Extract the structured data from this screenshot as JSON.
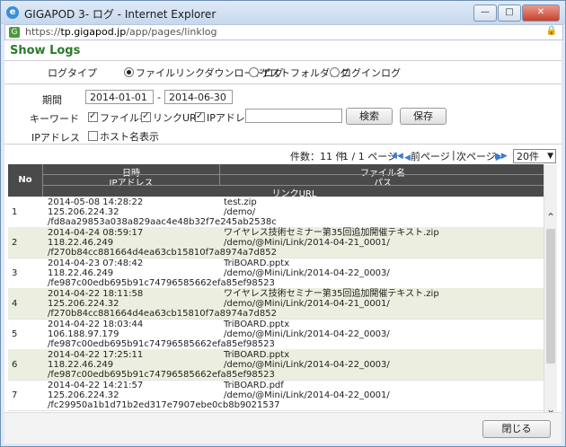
{
  "window": {
    "title": "GIGAPOD 3- ログ - Internet Explorer",
    "url_prefix": "https://",
    "url_host": "tp.gigapod.jp",
    "url_path": "/app/pages/linklog"
  },
  "page": {
    "heading": "Show Logs"
  },
  "filters": {
    "log_type_label": "ログタイプ",
    "log_types": [
      "ファイルリンクダウンロードログ",
      "ゲストフォルダログ",
      "ログインログ"
    ],
    "period_label": "期間",
    "date_from": "2014-01-01",
    "date_sep": "-",
    "date_to": "2014-06-30",
    "keyword_label": "キーワード",
    "kw_filename": "ファイル名",
    "kw_link_url": "リンクURL",
    "kw_ip": "IPアドレス",
    "keyword_value": "",
    "search_button": "検索",
    "save_button": "保存",
    "ip_label": "IPアドレス",
    "show_hostname": "ホスト名表示"
  },
  "pager": {
    "count_text": "件数：11 件",
    "page_text": "1 / 1 ページ",
    "prev": "前ページ",
    "divider": "|",
    "next": "次ページ",
    "per_page": "20件"
  },
  "table": {
    "h_no": "No",
    "h_datetime": "日時",
    "h_filename": "ファイル名",
    "h_ip": "IPアドレス",
    "h_path": "パス",
    "h_link": "リンクURL",
    "rows": [
      {
        "no": "1",
        "datetime": "2014-05-08 14:28:22",
        "file": "test.zip",
        "ip": "125.206.224.32",
        "path": "/demo/",
        "link": "/fd8aa29853a038a829aac4e48b32f7e245ab2538c"
      },
      {
        "no": "2",
        "datetime": "2014-04-24 08:59:17",
        "file": "ワイヤレス技術セミナー第35回追加開催テキスト.zip",
        "ip": "118.22.46.249",
        "path": "/demo/@Mini/Link/2014-04-21_0001/",
        "link": "/f270b84cc881664d4ea63cb15810f7a8974a7d852"
      },
      {
        "no": "3",
        "datetime": "2014-04-23 07:48:42",
        "file": "TriBOARD.pptx",
        "ip": "118.22.46.249",
        "path": "/demo/@Mini/Link/2014-04-22_0003/",
        "link": "/fe987c00edb695b91c74796585662efa85ef98523"
      },
      {
        "no": "4",
        "datetime": "2014-04-22 18:11:58",
        "file": "ワイヤレス技術セミナー第35回追加開催テキスト.zip",
        "ip": "125.206.224.32",
        "path": "/demo/@Mini/Link/2014-04-21_0001/",
        "link": "/f270b84cc881664d4ea63cb15810f7a8974a7d852"
      },
      {
        "no": "5",
        "datetime": "2014-04-22 18:03:44",
        "file": "TriBOARD.pptx",
        "ip": "106.188.97.179",
        "path": "/demo/@Mini/Link/2014-04-22_0003/",
        "link": "/fe987c00edb695b91c74796585662efa85ef98523"
      },
      {
        "no": "6",
        "datetime": "2014-04-22 17:25:11",
        "file": "TriBOARD.pptx",
        "ip": "118.22.46.249",
        "path": "/demo/@Mini/Link/2014-04-22_0003/",
        "link": "/fe987c00edb695b91c74796585662efa85ef98523"
      },
      {
        "no": "7",
        "datetime": "2014-04-22 14:21:57",
        "file": "TriBOARD.pdf",
        "ip": "125.206.224.32",
        "path": "/demo/@Mini/Link/2014-04-22_0001/",
        "link": "/fc29950a1b1d71b2ed317e7907ebe0cb8b9021537"
      }
    ]
  },
  "footer": {
    "close_button": "閉じる"
  }
}
